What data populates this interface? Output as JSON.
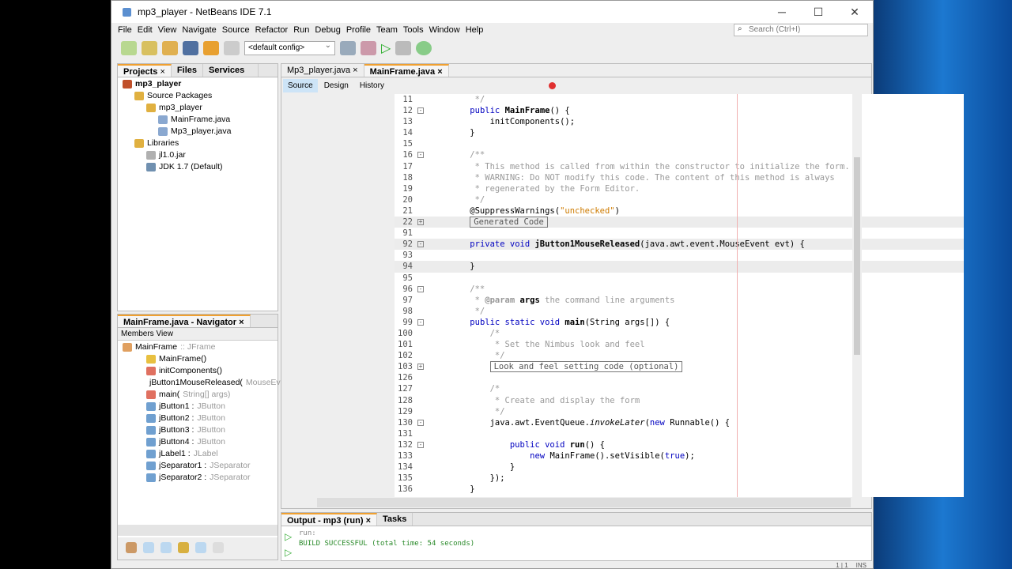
{
  "window": {
    "title": "mp3_player - NetBeans IDE 7.1",
    "controls": [
      "─",
      "☐",
      "✕"
    ]
  },
  "menu": [
    "File",
    "Edit",
    "View",
    "Navigate",
    "Source",
    "Refactor",
    "Run",
    "Debug",
    "Profile",
    "Team",
    "Tools",
    "Window",
    "Help"
  ],
  "search": {
    "placeholder": "Search (Ctrl+I)"
  },
  "toolbar": {
    "config": "<default config>"
  },
  "projects": {
    "tabs": [
      "Projects",
      "Files",
      "Services"
    ],
    "tree": [
      {
        "label": "mp3_player",
        "lvl": 0,
        "bold": true,
        "c": "#c0502a"
      },
      {
        "label": "Source Packages",
        "lvl": 1,
        "c": "#e0b040"
      },
      {
        "label": "mp3_player",
        "lvl": 2,
        "c": "#e0b040"
      },
      {
        "label": "MainFrame.java",
        "lvl": 3,
        "c": "#8aa8d0"
      },
      {
        "label": "Mp3_player.java",
        "lvl": 3,
        "c": "#8aa8d0"
      },
      {
        "label": "Libraries",
        "lvl": 1,
        "c": "#e0b040"
      },
      {
        "label": "jl1.0.jar",
        "lvl": 2,
        "c": "#b0b0b0"
      },
      {
        "label": "JDK 1.7 (Default)",
        "lvl": 2,
        "c": "#7090b0"
      }
    ]
  },
  "navigator": {
    "title": "MainFrame.java - Navigator",
    "view": "Members View",
    "items": [
      {
        "name": "MainFrame",
        "type": " :: JFrame",
        "lvl": 0,
        "c": "#e0a060"
      },
      {
        "name": "MainFrame()",
        "type": "",
        "lvl": 1,
        "c": "#e8c040"
      },
      {
        "name": "initComponents()",
        "type": "",
        "lvl": 1,
        "c": "#e07060"
      },
      {
        "name": "jButton1MouseReleased(",
        "type": "MouseEvent",
        "lvl": 1,
        "c": "#e07060"
      },
      {
        "name": "main(",
        "type": "String[] args)",
        "lvl": 1,
        "c": "#e07060"
      },
      {
        "name": "jButton1 : ",
        "type": "JButton",
        "lvl": 1,
        "c": "#70a0d0"
      },
      {
        "name": "jButton2 : ",
        "type": "JButton",
        "lvl": 1,
        "c": "#70a0d0"
      },
      {
        "name": "jButton3 : ",
        "type": "JButton",
        "lvl": 1,
        "c": "#70a0d0"
      },
      {
        "name": "jButton4 : ",
        "type": "JButton",
        "lvl": 1,
        "c": "#70a0d0"
      },
      {
        "name": "jLabel1 : ",
        "type": "JLabel",
        "lvl": 1,
        "c": "#70a0d0"
      },
      {
        "name": "jSeparator1 : ",
        "type": "JSeparator",
        "lvl": 1,
        "c": "#70a0d0"
      },
      {
        "name": "jSeparator2 : ",
        "type": "JSeparator",
        "lvl": 1,
        "c": "#70a0d0"
      }
    ]
  },
  "editor": {
    "tabs": [
      "Mp3_player.java",
      "MainFrame.java"
    ],
    "modes": [
      "Source",
      "Design",
      "History"
    ],
    "lines": [
      {
        "n": "11",
        "f": "",
        "s": [
          {
            "t": "     */",
            "c": "c"
          }
        ]
      },
      {
        "n": "12",
        "f": "-",
        "s": [
          {
            "t": "    "
          },
          {
            "t": "public ",
            "c": "k"
          },
          {
            "t": "MainFrame",
            "c": "b"
          },
          {
            "t": "() {"
          }
        ]
      },
      {
        "n": "13",
        "f": "",
        "s": [
          {
            "t": "        initComponents();"
          }
        ]
      },
      {
        "n": "14",
        "f": "",
        "s": [
          {
            "t": "    }"
          }
        ]
      },
      {
        "n": "15",
        "f": "",
        "s": []
      },
      {
        "n": "16",
        "f": "-",
        "s": [
          {
            "t": "    /**",
            "c": "c"
          }
        ]
      },
      {
        "n": "17",
        "f": "",
        "s": [
          {
            "t": "     * This method is called from within the constructor to initialize the form.",
            "c": "c"
          }
        ]
      },
      {
        "n": "18",
        "f": "",
        "s": [
          {
            "t": "     * WARNING: Do NOT modify this code. The content of this method is always",
            "c": "c"
          }
        ]
      },
      {
        "n": "19",
        "f": "",
        "s": [
          {
            "t": "     * regenerated by the Form Editor.",
            "c": "c"
          }
        ]
      },
      {
        "n": "20",
        "f": "",
        "s": [
          {
            "t": "     */",
            "c": "c"
          }
        ]
      },
      {
        "n": "21",
        "f": "",
        "s": [
          {
            "t": "    @SuppressWarnings("
          },
          {
            "t": "\"unchecked\"",
            "c": "s"
          },
          {
            "t": ")"
          }
        ]
      },
      {
        "n": "22",
        "f": "+",
        "hl": true,
        "s": [
          {
            "t": "    "
          },
          {
            "t": "Generated Code",
            "c": "box"
          }
        ]
      },
      {
        "n": "91",
        "f": "",
        "s": []
      },
      {
        "n": "92",
        "f": "-",
        "hl": true,
        "s": [
          {
            "t": "    "
          },
          {
            "t": "private void ",
            "c": "k"
          },
          {
            "t": "jButton1MouseReleased",
            "c": "b"
          },
          {
            "t": "(java.awt.event.MouseEvent evt) {"
          }
        ]
      },
      {
        "n": "93",
        "f": "",
        "s": []
      },
      {
        "n": "94",
        "f": "",
        "hl": true,
        "s": [
          {
            "t": "    }"
          }
        ]
      },
      {
        "n": "95",
        "f": "",
        "s": []
      },
      {
        "n": "96",
        "f": "-",
        "s": [
          {
            "t": "    /**",
            "c": "c"
          }
        ]
      },
      {
        "n": "97",
        "f": "",
        "s": [
          {
            "t": "     * ",
            "c": "c"
          },
          {
            "t": "@param",
            "c": "c b"
          },
          {
            "t": " args",
            "c": "b"
          },
          {
            "t": " the command line arguments",
            "c": "c"
          }
        ]
      },
      {
        "n": "98",
        "f": "",
        "s": [
          {
            "t": "     */",
            "c": "c"
          }
        ]
      },
      {
        "n": "99",
        "f": "-",
        "s": [
          {
            "t": "    "
          },
          {
            "t": "public static void ",
            "c": "k"
          },
          {
            "t": "main",
            "c": "b"
          },
          {
            "t": "(String args[]) {"
          }
        ]
      },
      {
        "n": "100",
        "f": "",
        "s": [
          {
            "t": "        /*",
            "c": "c"
          }
        ]
      },
      {
        "n": "101",
        "f": "",
        "s": [
          {
            "t": "         * Set the Nimbus look and feel",
            "c": "c"
          }
        ]
      },
      {
        "n": "102",
        "f": "",
        "s": [
          {
            "t": "         */",
            "c": "c"
          }
        ]
      },
      {
        "n": "103",
        "f": "+",
        "s": [
          {
            "t": "        "
          },
          {
            "t": "Look and feel setting code (optional)",
            "c": "box"
          }
        ]
      },
      {
        "n": "126",
        "f": "",
        "s": []
      },
      {
        "n": "127",
        "f": "",
        "s": [
          {
            "t": "        /*",
            "c": "c"
          }
        ]
      },
      {
        "n": "128",
        "f": "",
        "s": [
          {
            "t": "         * Create and display the form",
            "c": "c"
          }
        ]
      },
      {
        "n": "129",
        "f": "",
        "s": [
          {
            "t": "         */",
            "c": "c"
          }
        ]
      },
      {
        "n": "130",
        "f": "-",
        "s": [
          {
            "t": "        java.awt.EventQueue."
          },
          {
            "t": "invokeLater",
            "c": "i"
          },
          {
            "t": "("
          },
          {
            "t": "new ",
            "c": "k"
          },
          {
            "t": "Runnable() {"
          }
        ]
      },
      {
        "n": "131",
        "f": "",
        "s": []
      },
      {
        "n": "132",
        "f": "-",
        "s": [
          {
            "t": "            "
          },
          {
            "t": "public void ",
            "c": "k"
          },
          {
            "t": "run",
            "c": "b"
          },
          {
            "t": "() {"
          }
        ]
      },
      {
        "n": "133",
        "f": "",
        "s": [
          {
            "t": "                "
          },
          {
            "t": "new ",
            "c": "k"
          },
          {
            "t": "MainFrame().setVisible("
          },
          {
            "t": "true",
            "c": "k"
          },
          {
            "t": ");"
          }
        ]
      },
      {
        "n": "134",
        "f": "",
        "s": [
          {
            "t": "            }"
          }
        ]
      },
      {
        "n": "135",
        "f": "",
        "s": [
          {
            "t": "        });"
          }
        ]
      },
      {
        "n": "136",
        "f": "",
        "s": [
          {
            "t": "    }"
          }
        ]
      }
    ]
  },
  "output": {
    "tabs": [
      "Output - mp3 (run)",
      "Tasks"
    ],
    "lines": [
      "run:",
      "BUILD SUCCESSFUL (total time: 54 seconds)"
    ]
  },
  "status": {
    "position": "1 | 1",
    "mode": "INS"
  }
}
